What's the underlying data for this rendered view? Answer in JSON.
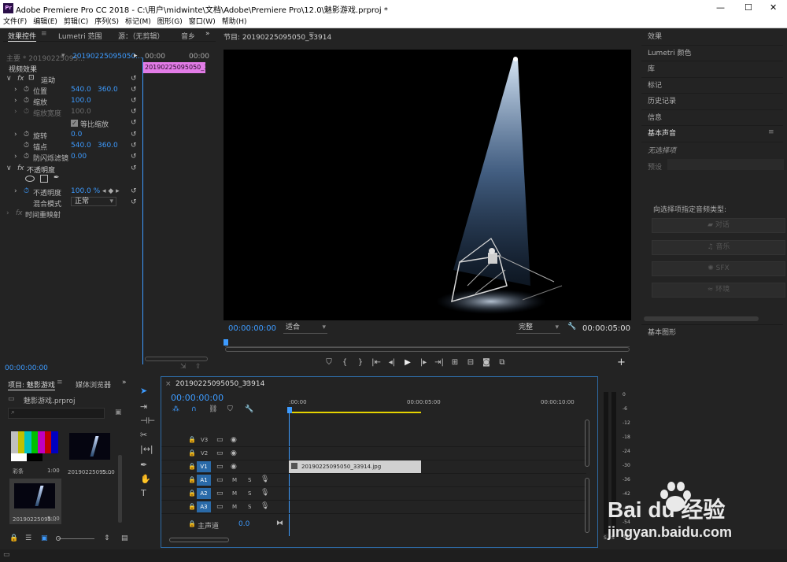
{
  "window": {
    "title": "Adobe Premiere Pro CC 2018 - C:\\用户\\midwinte\\文档\\Adobe\\Premiere Pro\\12.0\\魅影游戏.prproj *",
    "app_icon": "Pr",
    "controls": [
      "—",
      "☐",
      "✕"
    ]
  },
  "menu": [
    "文件(F)",
    "编辑(E)",
    "剪辑(C)",
    "序列(S)",
    "标记(M)",
    "图形(G)",
    "窗口(W)",
    "帮助(H)"
  ],
  "effect_controls": {
    "tabs": [
      "效果控件",
      "Lumetri 范围",
      "源：（无剪辑）",
      "音乡"
    ],
    "master": "主要 * 20190225095...",
    "seq": "20190225095050...",
    "time_start": "00:00",
    "time_end": "00:00",
    "clip_label": "20190225095050_3391",
    "section_video": "视频效果",
    "motion": "运动",
    "pos_label": "位置",
    "pos_x": "540.0",
    "pos_y": "360.0",
    "scale_label": "缩放",
    "scale_val": "100.0",
    "scalew_label": "缩放宽度",
    "scalew_val": "100.0",
    "uniform_label": "等比缩放",
    "rot_label": "旋转",
    "rot_val": "0.0",
    "anchor_label": "锚点",
    "anchor_x": "540.0",
    "anchor_y": "360.0",
    "flicker_label": "防闪烁滤镜",
    "flicker_val": "0.00",
    "opacity_section": "不透明度",
    "opacity_label": "不透明度",
    "opacity_val": "100.0 %",
    "blend_label": "混合模式",
    "blend_val": "正常",
    "time_remap": "时间重映射",
    "timecode": "00:00:00:00"
  },
  "program": {
    "title": "节目: 20190225095050_33914",
    "timecode": "00:00:00:00",
    "fit": "适合",
    "quality": "完整",
    "duration": "00:00:05:00"
  },
  "project": {
    "tabs": [
      "项目: 魅影游戏",
      "媒体浏览器"
    ],
    "file": "魅影游戏.prproj",
    "items": [
      {
        "name": "彩条",
        "dur": "1:00"
      },
      {
        "name": "20190225095...",
        "dur": "5:00"
      },
      {
        "name": "20190225095...",
        "dur": "5:00"
      }
    ]
  },
  "timeline": {
    "tab": "20190225095050_33914",
    "timecode": "00:00:00:00",
    "ruler": [
      ":00:00",
      "00:00:05:00",
      "00:00:10:00"
    ],
    "video_tracks": [
      "V3",
      "V2",
      "V1"
    ],
    "audio_tracks": [
      "A1",
      "A2",
      "A3"
    ],
    "master_label": "主声道",
    "master_val": "0.0",
    "clip_name": "20190225095050_33914.jpg",
    "m": "M",
    "s": "S"
  },
  "meters": [
    "0",
    "-6",
    "-12",
    "-18",
    "-24",
    "-30",
    "-36",
    "-42",
    "-48",
    "-54",
    "dB"
  ],
  "right_panels": [
    "效果",
    "Lumetri 颜色",
    "库",
    "标记",
    "历史记录",
    "信息",
    "基本声音"
  ],
  "essential_sound": {
    "none_selected": "无选择项",
    "preset": "预设",
    "prompt": "向选择项指定音频类型:",
    "buttons": [
      "对话",
      "音乐",
      "SFX",
      "环境"
    ]
  },
  "basic_graphics": "基本图形",
  "watermark": {
    "brand": "Bai du 经验",
    "url": "jingyan.baidu.com"
  },
  "colors": {
    "accent": "#3d9bff",
    "panel": "#232323",
    "clip": "#d0d0d0",
    "pink": "#e27ce7",
    "yellow": "#e5d300"
  }
}
